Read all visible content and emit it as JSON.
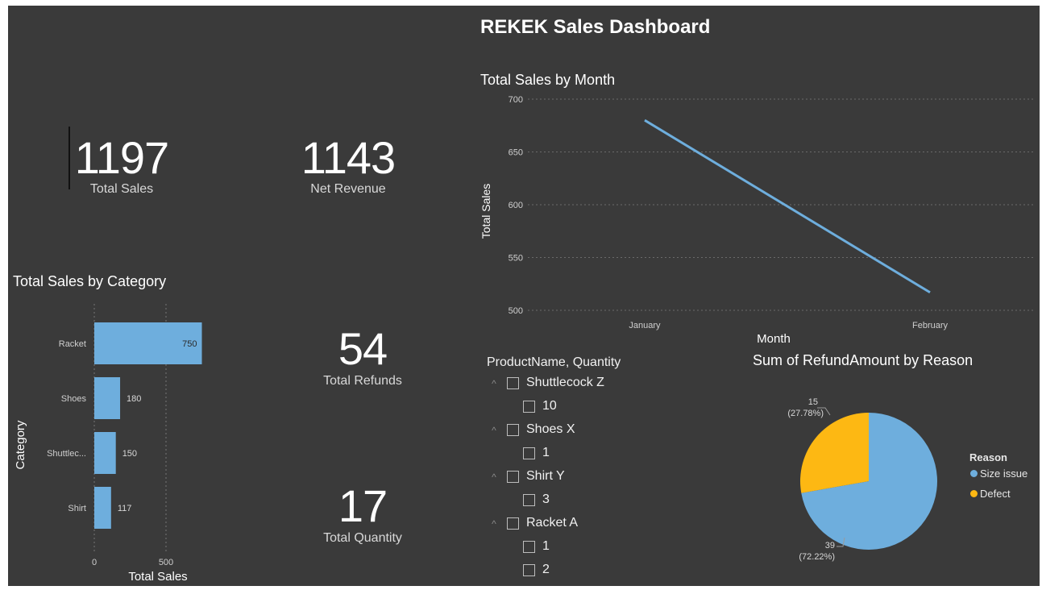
{
  "dashboard": {
    "title": "REKEK Sales Dashboard"
  },
  "cards": {
    "total_sales": {
      "value": "1197",
      "label": "Total Sales"
    },
    "net_revenue": {
      "value": "1143",
      "label": "Net Revenue"
    },
    "total_refunds": {
      "value": "54",
      "label": "Total Refunds"
    },
    "total_quantity": {
      "value": "17",
      "label": "Total Quantity"
    }
  },
  "bar_chart": {
    "title": "Total Sales by Category",
    "xlabel": "Total Sales",
    "ylabel": "Category",
    "ticks": [
      "0",
      "500"
    ],
    "display_categories": [
      "Racket",
      "Shoes",
      "Shuttlec...",
      "Shirt"
    ]
  },
  "line_chart": {
    "title": "Total Sales by Month",
    "xlabel": "Month",
    "ylabel": "Total Sales",
    "yticks": [
      "700",
      "650",
      "600",
      "550",
      "500"
    ]
  },
  "slicer": {
    "title": "ProductName, Quantity",
    "groups": [
      {
        "name": "Shuttlecock Z",
        "items": [
          "10"
        ]
      },
      {
        "name": "Shoes X",
        "items": [
          "1"
        ]
      },
      {
        "name": "Shirt Y",
        "items": [
          "3"
        ]
      },
      {
        "name": "Racket A",
        "items": [
          "1",
          "2"
        ]
      }
    ]
  },
  "pie_chart": {
    "title": "Sum of RefundAmount by Reason",
    "legend_title": "Reason",
    "labels": [
      {
        "value": "39",
        "percent": "(72.22%)"
      },
      {
        "value": "15",
        "percent": "(27.78%)"
      }
    ],
    "legend": [
      "Size issue",
      "Defect"
    ]
  },
  "colors": {
    "background": "#3a3a3a",
    "bar": "#6eaedd",
    "line": "#6eaedd",
    "size_issue": "#6eaedd",
    "defect": "#fdb813"
  },
  "chart_data": [
    {
      "type": "bar",
      "title": "Total Sales by Category",
      "categories": [
        "Racket",
        "Shoes",
        "Shuttlecock",
        "Shirt"
      ],
      "values": [
        750,
        180,
        150,
        117
      ],
      "xlabel": "Total Sales",
      "ylabel": "Category",
      "xlim": [
        0,
        750
      ],
      "orientation": "horizontal",
      "grid": true
    },
    {
      "type": "line",
      "title": "Total Sales by Month",
      "x": [
        "January",
        "February"
      ],
      "values": [
        680,
        517
      ],
      "xlabel": "Month",
      "ylabel": "Total Sales",
      "ylim": [
        500,
        700
      ],
      "grid": true
    },
    {
      "type": "pie",
      "title": "Sum of RefundAmount by Reason",
      "categories": [
        "Size issue",
        "Defect"
      ],
      "values": [
        39,
        15
      ],
      "percents": [
        72.22,
        27.78
      ],
      "legend_position": "right"
    }
  ]
}
